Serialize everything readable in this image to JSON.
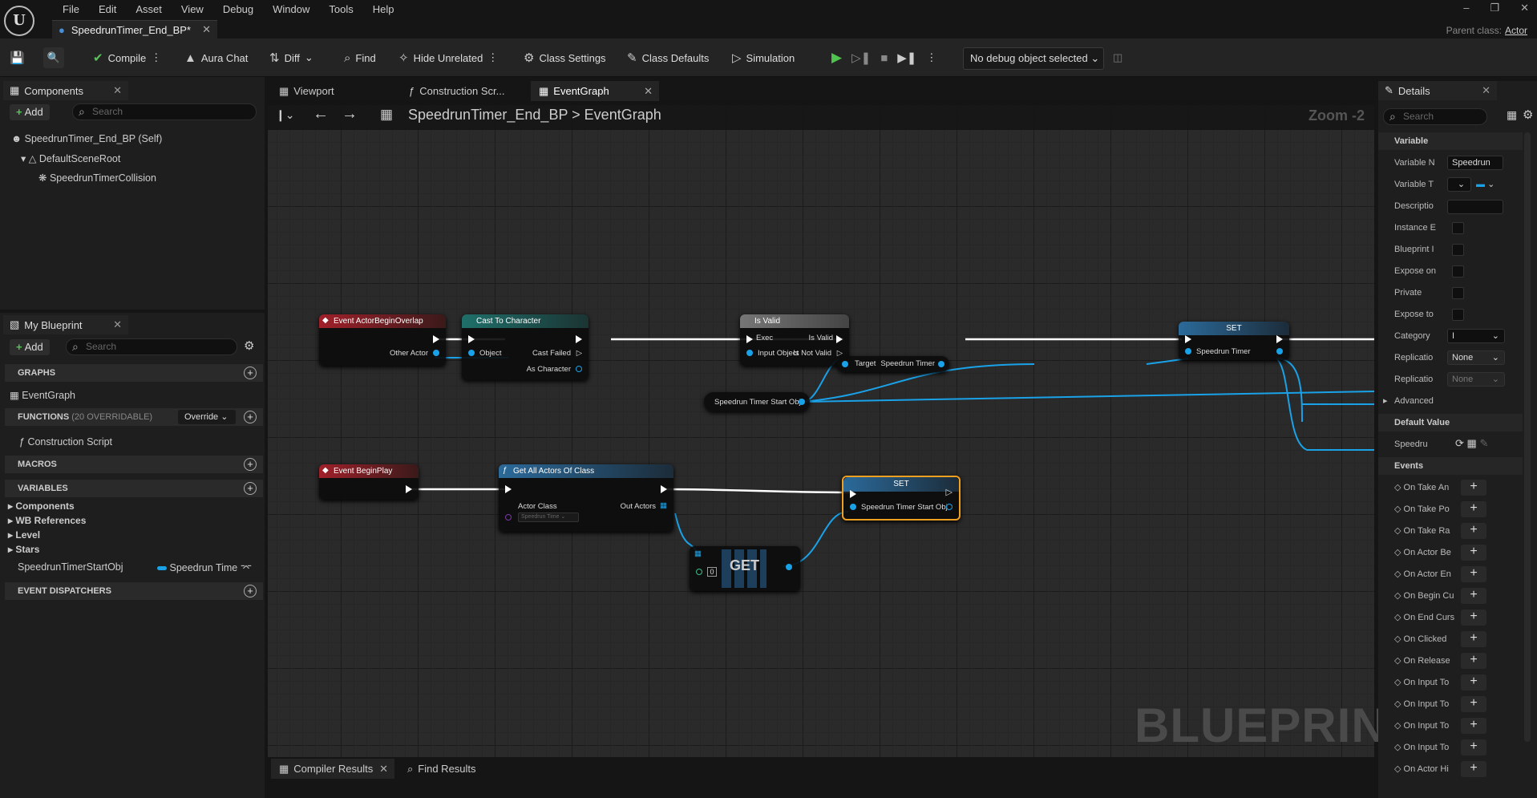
{
  "menubar": {
    "items": [
      "File",
      "Edit",
      "Asset",
      "View",
      "Debug",
      "Window",
      "Tools",
      "Help"
    ],
    "doc_tab": "SpeedrunTimer_End_BP*",
    "parent_label": "Parent class:",
    "parent_value": "Actor"
  },
  "toolbar": {
    "compile": "Compile",
    "aura": "Aura Chat",
    "diff": "Diff",
    "find": "Find",
    "hide_unrelated": "Hide Unrelated",
    "class_settings": "Class Settings",
    "class_defaults": "Class Defaults",
    "simulation": "Simulation",
    "debug_object": "No debug object selected"
  },
  "components": {
    "tab": "Components",
    "add": "Add",
    "search_placeholder": "Search",
    "items": [
      "SpeedrunTimer_End_BP (Self)",
      "DefaultSceneRoot",
      "SpeedrunTimerCollision"
    ]
  },
  "my_blueprint": {
    "tab": "My Blueprint",
    "add": "Add",
    "search_placeholder": "Search",
    "graphs": "GRAPHS",
    "event_graph": "EventGraph",
    "functions": "FUNCTIONS",
    "functions_note": "(20 OVERRIDABLE)",
    "override": "Override",
    "construction_script": "Construction Script",
    "macros": "MACROS",
    "variables": "VARIABLES",
    "var_groups": [
      "Components",
      "WB References",
      "Level",
      "Stars"
    ],
    "var_name": "SpeedrunTimerStartObj",
    "var_type": "Speedrun Time",
    "event_dispatchers": "EVENT DISPATCHERS"
  },
  "graph": {
    "tabs": [
      "Viewport",
      "Construction Scr...",
      "EventGraph"
    ],
    "breadcrumb_bp": "SpeedrunTimer_End_BP",
    "breadcrumb_sep": ">",
    "breadcrumb_graph": "EventGraph",
    "zoom": "Zoom -2",
    "watermark": "BLUEPRINT",
    "nodes": {
      "overlap_title": "Event ActorBeginOverlap",
      "overlap_pin": "Other Actor",
      "cast_title": "Cast To Character",
      "cast_object": "Object",
      "cast_failed": "Cast Failed",
      "cast_as": "As Character",
      "isvalid_title": "Is Valid",
      "isvalid_exec": "Exec",
      "isvalid_valid": "Is Valid",
      "isvalid_input": "Input Object",
      "isvalid_notvalid": "Is Not Valid",
      "target": "Target",
      "speedrun_timer": "Speedrun Timer",
      "set1_title": "SET",
      "set1_pin": "Speedrun Timer",
      "start_obj": "Speedrun Timer Start Obj",
      "beginplay_title": "Event BeginPlay",
      "getall_title": "Get All Actors Of Class",
      "actor_class": "Actor Class",
      "actor_class_value": "Speedrun Time",
      "out_actors": "Out Actors",
      "set2_title": "SET",
      "set2_pin": "Speedrun Timer Start Obj",
      "get_title": "GET",
      "get_index": "0"
    }
  },
  "bottom": {
    "compiler": "Compiler Results",
    "find": "Find Results"
  },
  "details": {
    "tab": "Details",
    "search_placeholder": "Search",
    "variable": "Variable",
    "rows": [
      "Variable N",
      "Variable T",
      "Descriptio",
      "Instance E",
      "Blueprint I",
      "Expose on",
      "Private",
      "Expose to",
      "Category",
      "Replicatio",
      "Replicatio"
    ],
    "var_name_value": "Speedrun",
    "category_value": "I",
    "rep1": "None",
    "rep2": "None",
    "advanced": "Advanced",
    "default_value": "Default Value",
    "default_row": "Speedru",
    "events": "Events",
    "event_rows": [
      "On Take An",
      "On Take Po",
      "On Take Ra",
      "On Actor Be",
      "On Actor En",
      "On Begin Cu",
      "On End Curs",
      "On Clicked",
      "On Release",
      "On Input To",
      "On Input To",
      "On Input To",
      "On Input To",
      "On Actor Hi"
    ]
  }
}
